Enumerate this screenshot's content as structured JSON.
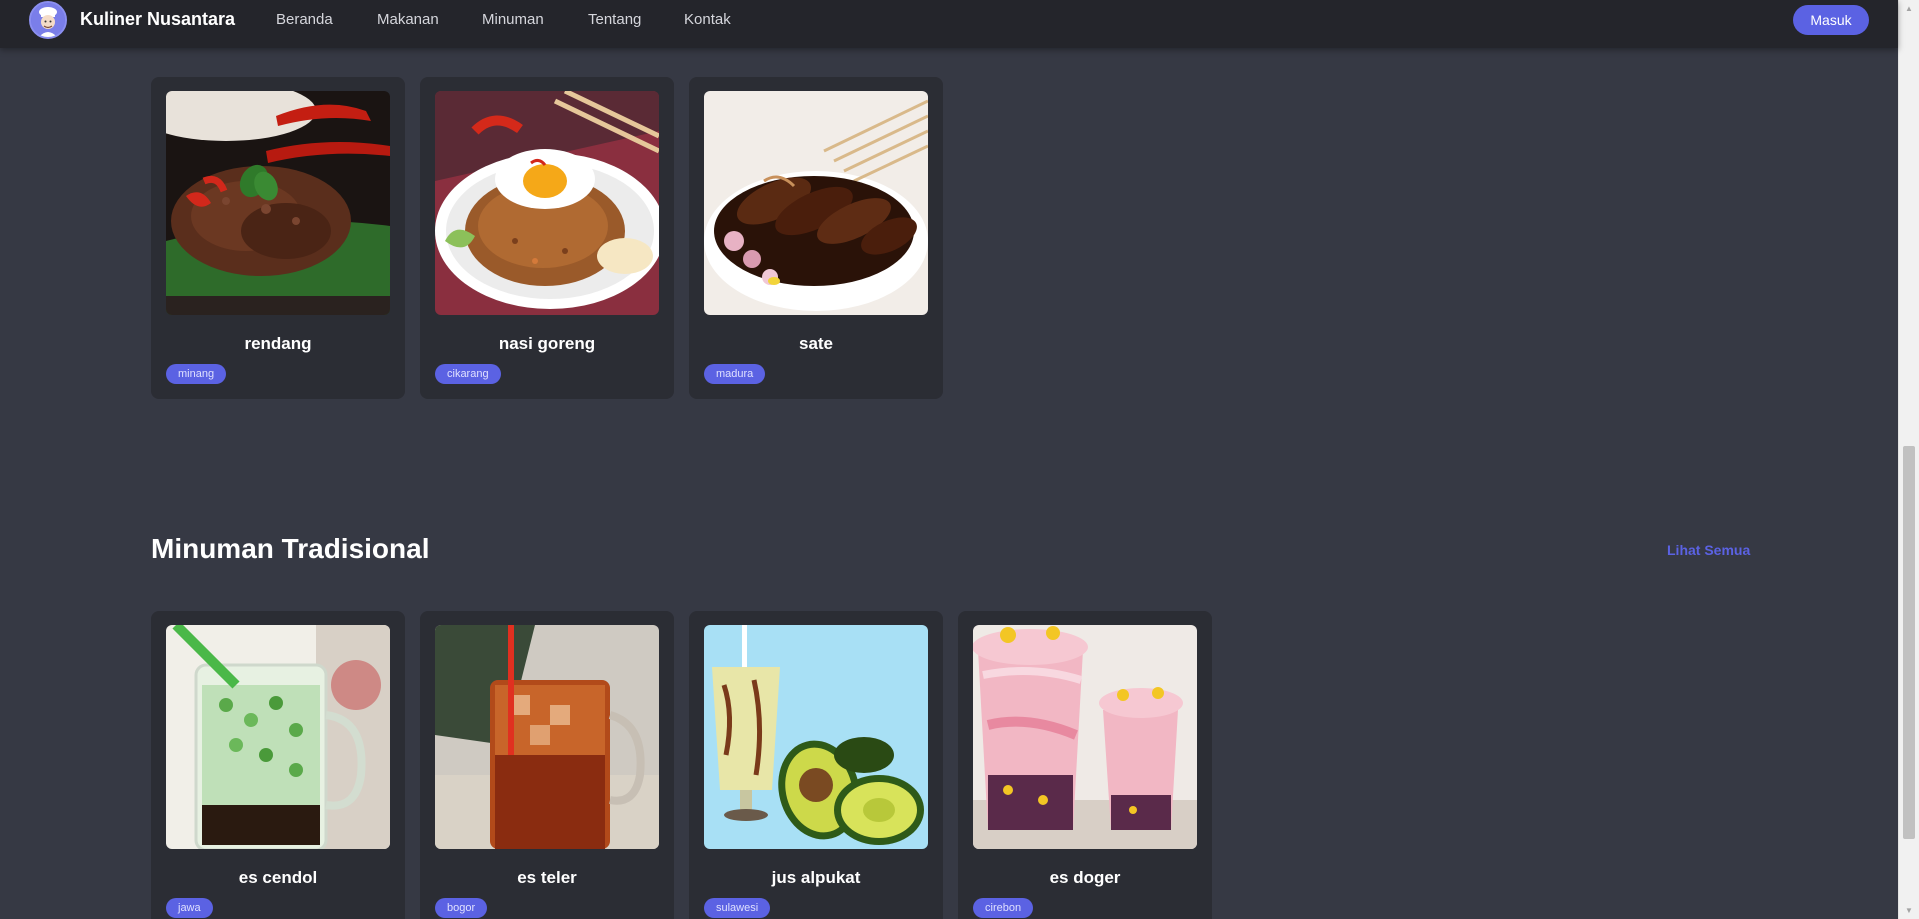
{
  "brand": {
    "name": "Kuliner Nusantara"
  },
  "nav": {
    "links": [
      "Beranda",
      "Makanan",
      "Minuman",
      "Tentang",
      "Kontak"
    ],
    "login_label": "Masuk"
  },
  "food_cards": [
    {
      "name": "rendang",
      "tag": "minang"
    },
    {
      "name": "nasi goreng",
      "tag": "cikarang"
    },
    {
      "name": "sate",
      "tag": "madura"
    }
  ],
  "drinks_section": {
    "title": "Minuman Tradisional",
    "see_all_label": "Lihat Semua"
  },
  "drink_cards": [
    {
      "name": "es cendol",
      "tag": "jawa"
    },
    {
      "name": "es teler",
      "tag": "bogor"
    },
    {
      "name": "jus alpukat",
      "tag": "sulawesi"
    },
    {
      "name": "es doger",
      "tag": "cirebon"
    }
  ],
  "colors": {
    "background": "#363944",
    "navbar": "#24252b",
    "card": "#2b2d34",
    "accent": "#5b62e3"
  }
}
